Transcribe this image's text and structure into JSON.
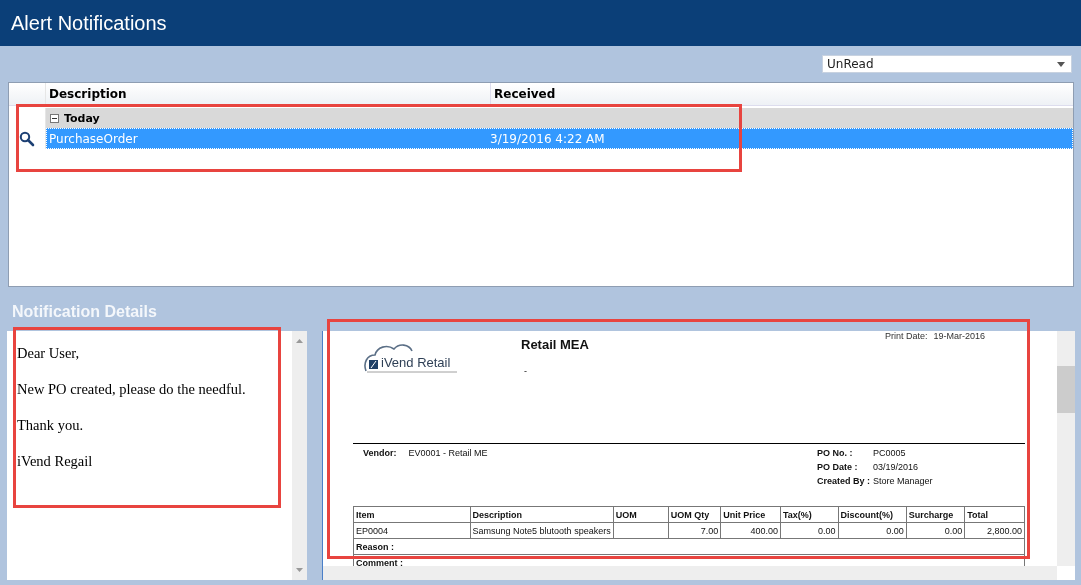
{
  "window": {
    "title": "Alert Notifications"
  },
  "filter": {
    "value": "UnRead"
  },
  "grid": {
    "highlighted": true,
    "columns": [
      "Description",
      "Received"
    ],
    "groups": [
      {
        "label": "Today",
        "expanded": true,
        "rows": [
          {
            "description": "PurchaseOrder",
            "received": "3/19/2016 4:22 AM",
            "selected": true
          }
        ]
      }
    ]
  },
  "details": {
    "title": "Notification Details",
    "highlighted": true,
    "message": [
      "Dear User,",
      "New PO created, please do the needful.",
      "Thank you.",
      "iVend Regail"
    ]
  },
  "report": {
    "highlighted": true,
    "logo_text": "iVend Retail",
    "company": "Retail MEA",
    "subtitle": "-",
    "print_date_label": "Print Date:",
    "print_date": "19-Mar-2016",
    "vendor_label": "Vendor:",
    "vendor": "EV0001 - Retail ME",
    "fields": [
      {
        "label": "PO No. :",
        "value": "PC0005"
      },
      {
        "label": "PO Date :",
        "value": "03/19/2016"
      },
      {
        "label": "Created By :",
        "value": "Store  Manager"
      }
    ],
    "columns": [
      "Item",
      "Description",
      "UOM",
      "UOM Qty",
      "Unit Price",
      "Tax(%)",
      "Discount(%)",
      "Surcharge",
      "Total"
    ],
    "rows": [
      [
        "EP0004",
        "Samsung Note5 blutooth speakers",
        "",
        "7.00",
        "400.00",
        "0.00",
        "0.00",
        "0.00",
        "2,800.00"
      ]
    ],
    "reason_label": "Reason :",
    "comment_label": "Comment :"
  }
}
